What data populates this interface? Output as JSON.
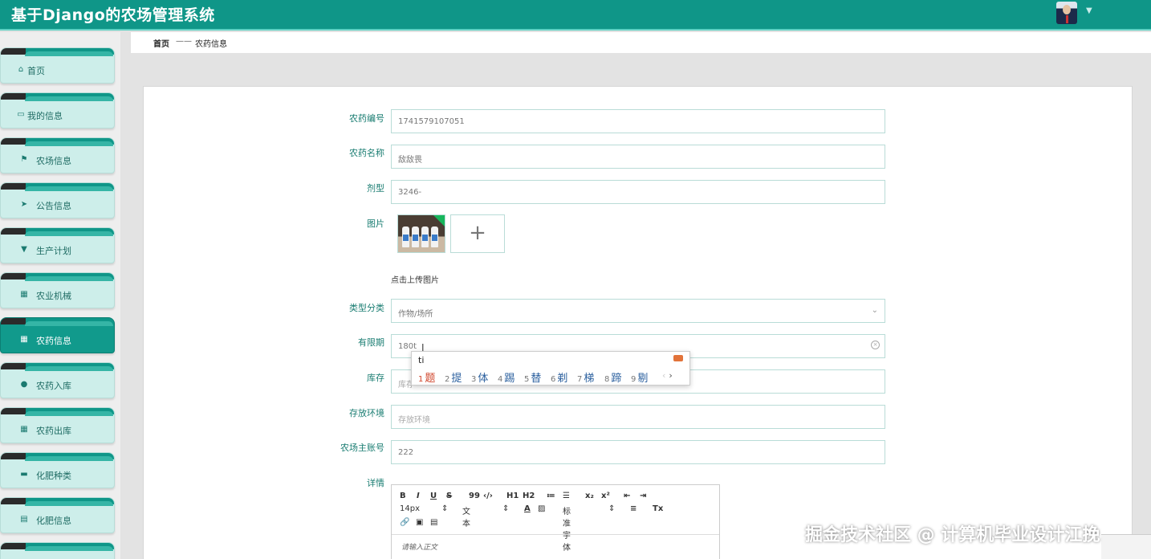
{
  "app": {
    "title": "基于Django的农场管理系统",
    "user_caret": "▼"
  },
  "sidebar": {
    "items": [
      {
        "label": "首页",
        "icon": "home-icon",
        "glyph": "⌂",
        "active": false
      },
      {
        "label": "我的信息",
        "icon": "profile-card-icon",
        "glyph": "▭",
        "active": false
      },
      {
        "label": "农场信息",
        "icon": "flag-icon",
        "glyph": "⚑",
        "active": false
      },
      {
        "label": "公告信息",
        "icon": "send-icon",
        "glyph": "➤",
        "active": false
      },
      {
        "label": "生产计划",
        "icon": "funnel-icon",
        "glyph": "▼",
        "active": false
      },
      {
        "label": "农业机械",
        "icon": "grid-icon",
        "glyph": "▦",
        "active": false
      },
      {
        "label": "农药信息",
        "icon": "grid-icon",
        "glyph": "▦",
        "active": true
      },
      {
        "label": "农药入库",
        "icon": "user-icon",
        "glyph": "●",
        "active": false
      },
      {
        "label": "农药出库",
        "icon": "grid-icon",
        "glyph": "▦",
        "active": false
      },
      {
        "label": "化肥种类",
        "icon": "ticket-icon",
        "glyph": "▬",
        "active": false
      },
      {
        "label": "化肥信息",
        "icon": "document-icon",
        "glyph": "▤",
        "active": false
      }
    ]
  },
  "breadcrumb": {
    "home": "首页",
    "separator": "——",
    "current": "农药信息"
  },
  "form": {
    "fields": {
      "code": {
        "label": "农药编号",
        "value": "1741579107051"
      },
      "name": {
        "label": "农药名称",
        "value": "敌敌畏"
      },
      "dosage_form": {
        "label": "剂型",
        "value": "3246-"
      },
      "image": {
        "label": "图片",
        "upload_hint": "点击上传图片",
        "add_glyph": "+"
      },
      "category": {
        "label": "类型分类",
        "value": "作物/场所",
        "arrow": "⌄"
      },
      "validity": {
        "label": "有限期",
        "value": "180t",
        "clear_glyph": "×"
      },
      "stock": {
        "label": "库存",
        "placeholder": "库存"
      },
      "storage": {
        "label": "存放环境",
        "placeholder": "存放环境"
      },
      "farm_owner": {
        "label": "农场主账号",
        "value": "222"
      },
      "details": {
        "label": "详情",
        "placeholder": "请输入正文"
      }
    }
  },
  "ime": {
    "composition": "ti",
    "candidates": [
      {
        "num": "1",
        "text": "题"
      },
      {
        "num": "2",
        "text": "提"
      },
      {
        "num": "3",
        "text": "体"
      },
      {
        "num": "4",
        "text": "踢"
      },
      {
        "num": "5",
        "text": "替"
      },
      {
        "num": "6",
        "text": "剃"
      },
      {
        "num": "7",
        "text": "梯"
      },
      {
        "num": "8",
        "text": "蹄"
      },
      {
        "num": "9",
        "text": "剔"
      }
    ],
    "nav_prev": "‹",
    "nav_next": "›"
  },
  "editor": {
    "font_size": "14px",
    "text_type": "文本",
    "font_family": "标准字体",
    "buttons": {
      "bold": "B",
      "italic": "I",
      "underline": "U",
      "strike": "S",
      "quote": "99",
      "code": "‹/›",
      "h1": "H1",
      "h2": "H2",
      "ordered_list": "≔",
      "bullet_list": "☰",
      "subscript": "x₂",
      "superscript": "x²",
      "outdent": "⇤",
      "indent": "⇥",
      "text_color": "A",
      "background": "▨",
      "align": "≡",
      "clear_format": "Tx",
      "link": "🔗",
      "image": "▣",
      "video": "▤",
      "dropdown_arrow": "⇕"
    }
  },
  "watermark": {
    "text": "掘金技术社区 @ 计算机毕业设计江挽"
  }
}
